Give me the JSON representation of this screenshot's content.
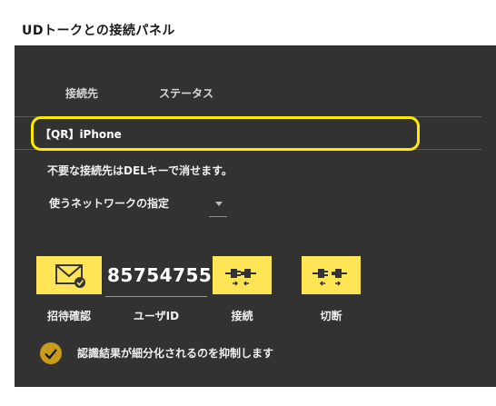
{
  "window": {
    "title": "UDトークとの接続パネル"
  },
  "list": {
    "columns": [
      "接続先",
      "ステータス"
    ],
    "rows": [
      {
        "name": "【QR】iPhone",
        "status": ""
      }
    ]
  },
  "hint": "不要な接続先はDELキーで消せます。",
  "network": {
    "label": "使うネットワークの指定",
    "selected": ""
  },
  "actions": {
    "invite_label": "招待確認",
    "user_id": "85754755",
    "user_id_label": "ユーザID",
    "connect_label": "接続",
    "disconnect_label": "切断"
  },
  "option": {
    "label": "認識結果が細分化されるのを抑制します",
    "checked": true
  },
  "colors": {
    "accent": "#ffe455",
    "highlight": "#ffea00",
    "panel": "#323232",
    "check": "#c89b18"
  },
  "icons": [
    "mail-check-icon",
    "plug-connect-icon",
    "plug-disconnect-icon",
    "checkmark-icon",
    "chevron-down-icon"
  ]
}
